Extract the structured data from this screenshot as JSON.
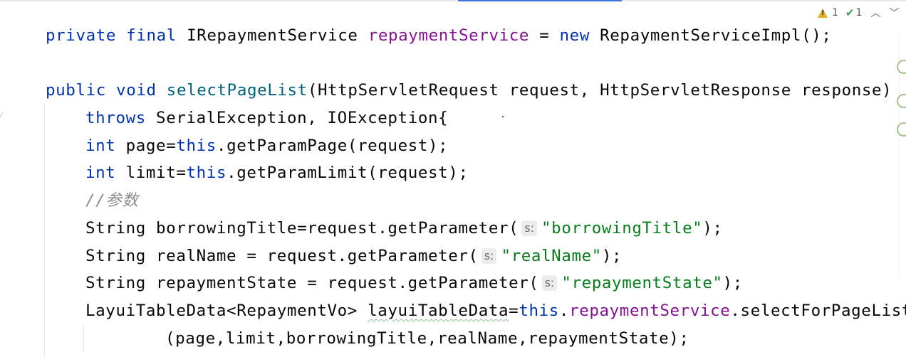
{
  "window": {
    "title": ""
  },
  "inspections": {
    "warning_count": "1",
    "weak_warning_count": "1",
    "up_icon": "chevron-up-icon",
    "down_icon": "chevron-down-icon"
  },
  "code": {
    "line1": {
      "kw_private": "private",
      "kw_final": "final",
      "type": "IRepaymentService",
      "field": "repaymentService",
      "eq": "=",
      "kw_new": "new",
      "ctor": "RepaymentServiceImpl();"
    },
    "line2": {
      "kw_public": "public",
      "kw_void": "void",
      "method": "selectPageList",
      "params": "(HttpServletRequest request, HttpServletResponse response)"
    },
    "line3": {
      "kw_throws": "throws",
      "rest": "SerialException, IOException{"
    },
    "line4": {
      "kw_int": "int",
      "a": "page=",
      "kw_this": "this",
      "b": ".getParamPage(request);"
    },
    "line5": {
      "kw_int": "int",
      "a": "limit=",
      "kw_this": "this",
      "b": ".getParamLimit(request);"
    },
    "line6": {
      "comment": "//参数"
    },
    "line7": {
      "a": "String borrowingTitle=request.getParameter(",
      "hint": "s:",
      "str": "\"borrowingTitle\"",
      "b": ");"
    },
    "line8": {
      "a": "String realName = request.getParameter(",
      "hint": "s:",
      "str": "\"realName\"",
      "b": ");"
    },
    "line9": {
      "a": "String repaymentState = request.getParameter(",
      "hint": "s:",
      "str": "\"repaymentState\"",
      "b": ");"
    },
    "line10": {
      "a": "LayuiTableData<RepaymentVo>",
      "var": "layuiTableData",
      "eq": "=",
      "kw_this": "this",
      "dot": ".",
      "field": "repaymentService",
      "b": ".selectForPageList"
    },
    "line11": {
      "a": "(page,limit,borrowingTitle,realName,repaymentState);"
    }
  },
  "colors": {
    "keyword": "#0033b3",
    "field": "#871094",
    "method": "#00627a",
    "string": "#067d17",
    "comment": "#8c8c8c",
    "warning": "#e0b022",
    "ok": "#3d9b49"
  }
}
